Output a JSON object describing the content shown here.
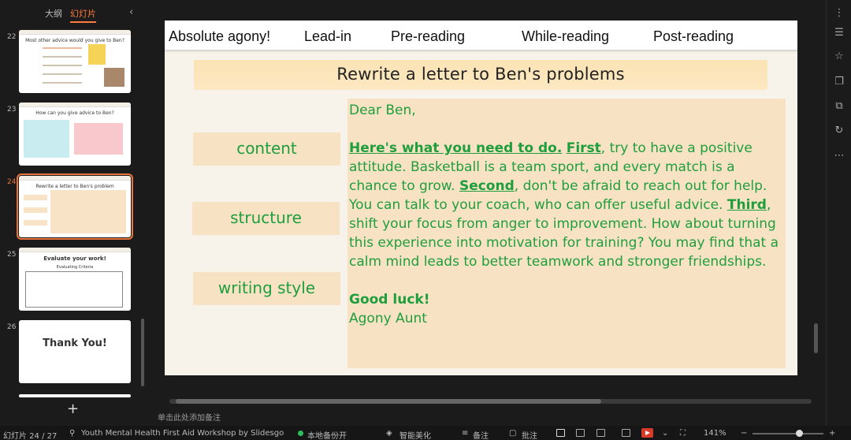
{
  "panel": {
    "tab_outline": "大纲",
    "tab_slides": "幻灯片",
    "collapse_icon": "chevron-left-icon",
    "slides": [
      {
        "number": "22",
        "title": "Most other advice would you give to Ben?"
      },
      {
        "number": "23",
        "title": "How can you give advice to Ben?"
      },
      {
        "number": "24",
        "title": "Rewrite a letter to Ben's problem"
      },
      {
        "number": "25",
        "title": "Evaluate your work!",
        "subtitle": "Evaluating Criteria"
      },
      {
        "number": "26",
        "title": "Thank You!"
      }
    ],
    "add_icon": "+"
  },
  "slide": {
    "nav": [
      "Absolute agony!",
      "Lead-in",
      "Pre-reading",
      "While-reading",
      "Post-reading"
    ],
    "title": "Rewrite a letter to Ben's problems",
    "labels": [
      "content",
      "structure",
      "writing style"
    ],
    "letter": {
      "greeting": "Dear Ben,",
      "intro_underlined": "Here's what you need to do.",
      "first_label": "First",
      "first_text": ", try to have a positive attitude. Basketball is a team sport, and every match is a chance to grow. ",
      "second_label": "Second",
      "second_text": ", don't be afraid to reach out for help. You can talk to your coach, who can offer useful advice. ",
      "third_label": "Third",
      "third_text": ", shift your focus from anger to improvement. How about turning this experience into motivation for training? You may find that a calm mind leads to better teamwork and stronger friendships.",
      "closing": "Good luck!",
      "signature": "Agony Aunt"
    }
  },
  "notes_placeholder": "单击此处添加备注",
  "status": {
    "slide_counter": "幻灯片 24 / 27",
    "theme": "Youth Mental Health First Aid Workshop by Slidesgo",
    "backup": "本地备份开",
    "beautify": "智能美化",
    "notes": "备注",
    "comments": "批注",
    "zoom": "141%"
  },
  "colors": {
    "accent": "#e8733b",
    "letter_text": "#1e9e3d",
    "label_bg": "#f8e2c4"
  }
}
